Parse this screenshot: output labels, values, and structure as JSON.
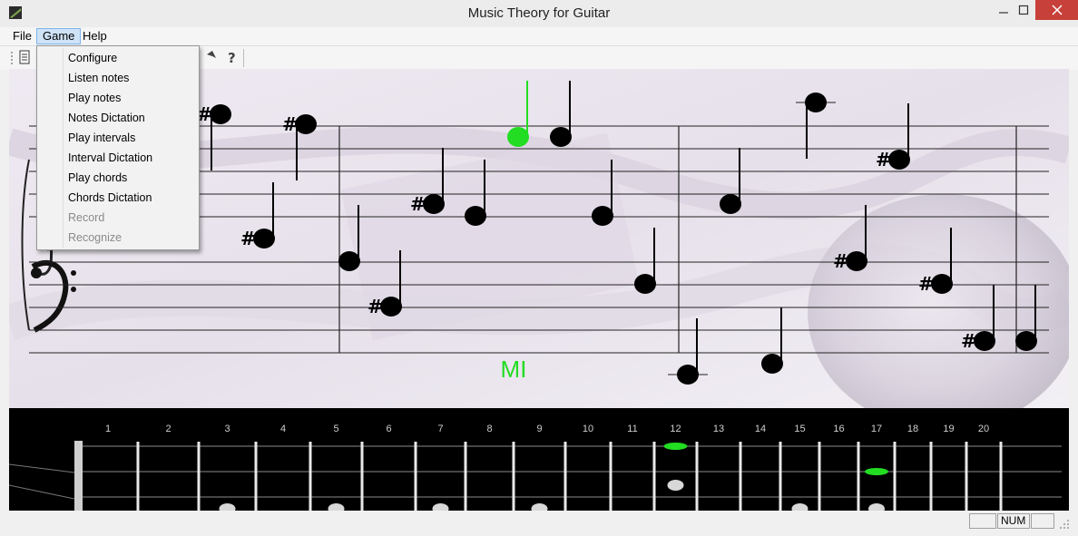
{
  "window": {
    "title": "Music Theory for Guitar"
  },
  "menubar": {
    "items": [
      "File",
      "Game",
      "Help"
    ]
  },
  "game_menu": {
    "items": [
      {
        "label": "Configure",
        "enabled": true
      },
      {
        "label": "Listen notes",
        "enabled": true
      },
      {
        "label": "Play notes",
        "enabled": true
      },
      {
        "label": "Notes Dictation",
        "enabled": true
      },
      {
        "label": "Play intervals",
        "enabled": true
      },
      {
        "label": "Interval Dictation",
        "enabled": true
      },
      {
        "label": "Play chords",
        "enabled": true
      },
      {
        "label": "Chords Dictation",
        "enabled": true
      },
      {
        "label": "Record",
        "enabled": false
      },
      {
        "label": "Recognize",
        "enabled": false
      }
    ]
  },
  "staff": {
    "current_note_name": "MI",
    "highlight_color": "#22dd22",
    "note_color": "#000000",
    "notes": [
      {
        "pitch": "A#3",
        "sharp": true
      },
      {
        "pitch": "G#3",
        "sharp": true
      },
      {
        "pitch": "E2",
        "sharp": true
      },
      {
        "pitch": "A#2",
        "sharp": true
      },
      {
        "pitch": "B2",
        "sharp": false
      },
      {
        "pitch": "F2",
        "sharp": true
      },
      {
        "pitch": "E3",
        "sharp": false,
        "active": true
      },
      {
        "pitch": "B3",
        "sharp": false
      },
      {
        "pitch": "C3",
        "sharp": false
      },
      {
        "pitch": "F3",
        "sharp": false
      },
      {
        "pitch": "E3",
        "sharp": false
      },
      {
        "pitch": "D3",
        "sharp": false
      },
      {
        "pitch": "C2",
        "sharp": false
      },
      {
        "pitch": "D2",
        "sharp": false
      },
      {
        "pitch": "F3",
        "sharp": true
      },
      {
        "pitch": "B4",
        "sharp": false
      },
      {
        "pitch": "E3",
        "sharp": true
      },
      {
        "pitch": "B2",
        "sharp": true
      },
      {
        "pitch": "B2",
        "sharp": true
      },
      {
        "pitch": "D2",
        "sharp": false
      },
      {
        "pitch": "D2",
        "sharp": false
      }
    ]
  },
  "fretboard": {
    "fret_numbers": [
      "1",
      "2",
      "3",
      "4",
      "5",
      "6",
      "7",
      "8",
      "9",
      "10",
      "11",
      "12",
      "13",
      "14",
      "15",
      "16",
      "17",
      "18",
      "19",
      "20"
    ],
    "active_marks": [
      {
        "fret": "12",
        "string": 1
      },
      {
        "fret": "17",
        "string": 2
      }
    ]
  },
  "statusbar": {
    "panes": [
      "",
      "NUM",
      ""
    ]
  }
}
